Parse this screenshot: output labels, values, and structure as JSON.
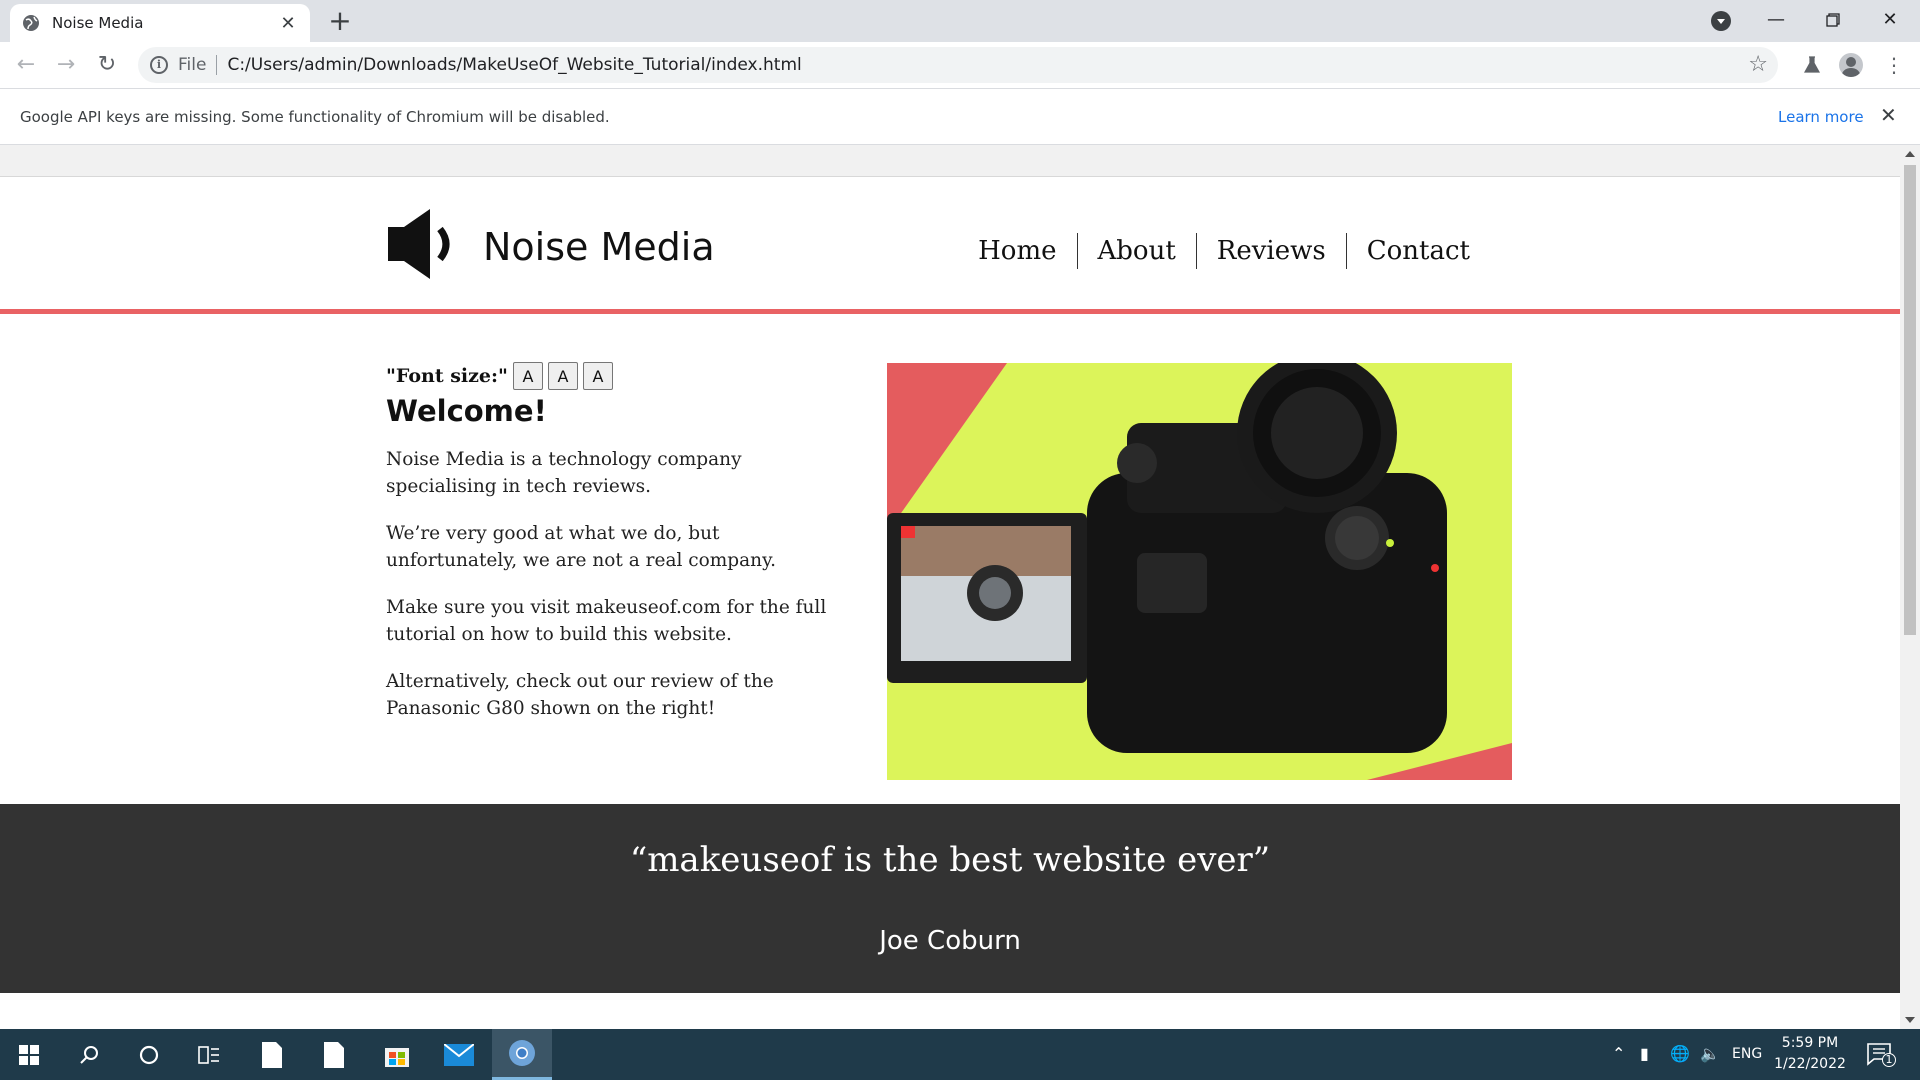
{
  "browser": {
    "tab_title": "Noise Media",
    "new_tab": "+",
    "tab_close": "✕",
    "address": {
      "scheme_label": "File",
      "url": "C:/Users/admin/Downloads/MakeUseOf_Website_Tutorial/index.html"
    },
    "infobar": {
      "message": "Google API keys are missing. Some functionality of Chromium will be disabled.",
      "link": "Learn more"
    }
  },
  "site": {
    "title": "Noise Media",
    "nav": [
      "Home",
      "About",
      "Reviews",
      "Contact"
    ],
    "font_size_label": "\"Font size:\"",
    "font_buttons": [
      "A",
      "A",
      "A"
    ],
    "welcome": "Welcome!",
    "paragraphs": [
      "Noise Media is a technology company specialising in tech reviews.",
      "We’re very good at what we do, but unfortunately, we are not a real company.",
      "Make sure you visit makeuseof.com for the full tutorial on how to build this website.",
      "Alternatively, check out our review of the Panasonic G80 shown on the right!"
    ],
    "quote": "“makeuseof is the best website ever”",
    "quote_author": "Joe Coburn",
    "colors": {
      "accent": "#e96264",
      "quote_band": "#333333",
      "hero_lime": "#dcf45a"
    }
  },
  "taskbar": {
    "language": "ENG",
    "time": "5:59 PM",
    "date": "1/22/2022",
    "notification_count": "1"
  }
}
